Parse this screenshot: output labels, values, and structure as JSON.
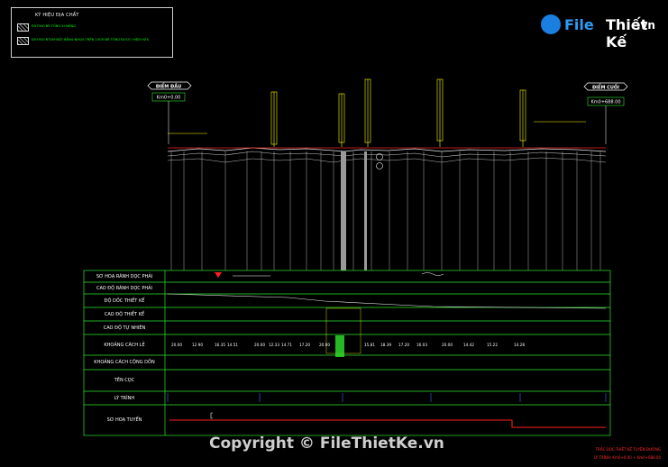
{
  "legend": {
    "title": "KÝ HIỆU ĐỊA CHẤT",
    "items": [
      {
        "label": "ĐƯỜNG BÊ TÔNG XI MĂNG"
      },
      {
        "label": "ĐƯỜNG BTXM MẶT BẰNG NHỰA TRÊN 10CM BÊ TÔNG ĐƯỢC HIỆN HỮU"
      }
    ]
  },
  "logo": {
    "part1": "File",
    "part2": "Thiết Kế",
    "part3": ".vn"
  },
  "chainage_start": {
    "label": "ĐIỂM ĐẦU",
    "value": "Km0+0.00"
  },
  "chainage_end": {
    "label": "ĐIỂM CUỐI",
    "value": "Km0+688.00"
  },
  "table_rows": [
    "SƠ HOẠ RÃNH DỌC PHẢI",
    "CAO ĐỘ RÃNH DỌC PHẢI",
    "ĐỘ DỐC THIẾT KẾ",
    "CAO ĐỘ THIẾT KẾ",
    "CAO ĐỘ TỰ NHIÊN",
    "KHOẢNG CÁCH LẺ",
    "KHOẢNG CÁCH CỘNG DỒN",
    "TÊN CỌC",
    "LÝ TRÌNH",
    "SƠ HOẠ TUYẾN"
  ],
  "spacing_values": [
    "20.00",
    "12.90",
    "16.35",
    "14.51",
    "20.00",
    "12.33",
    "14.71",
    "17.20",
    "20.00",
    "15.81",
    "18.39",
    "17.20",
    "16.03",
    "20.00",
    "14.42",
    "15.22",
    "14.28"
  ],
  "sheet_title": "TRẮC DỌC THIẾT KẾ TUYẾN ĐƯỜNG",
  "sheet_subtitle": "LÝ TRÌNH: Km0+0.00 ÷ Km0+688.00",
  "copyright": "Copyright © FileThietKe.vn",
  "colors": {
    "background": "#000000",
    "grid": "#2ee62e",
    "profile_white": "#e6e6e6",
    "design_red": "#ff2020",
    "annotation_yellow": "#ffff00",
    "station_blue": "#3b6dff"
  }
}
